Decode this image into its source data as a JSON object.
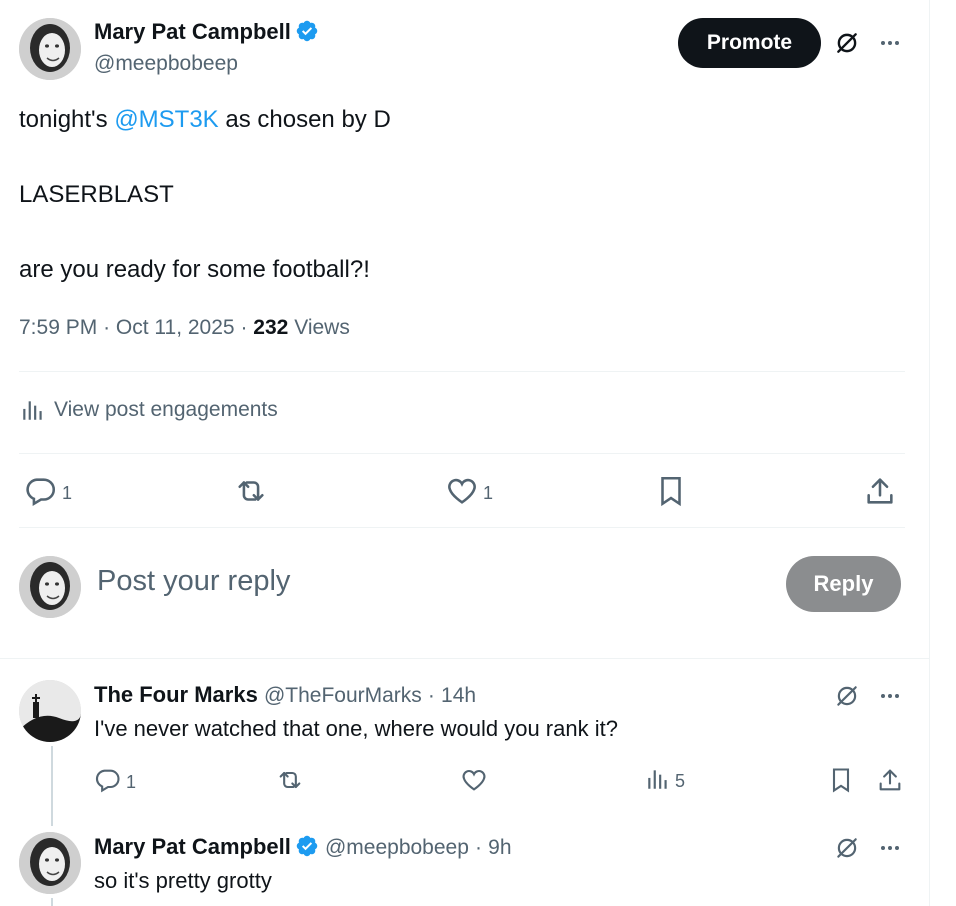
{
  "main_post": {
    "author_name": "Mary Pat Campbell",
    "author_handle": "@meepbobeep",
    "promote_label": "Promote",
    "text_prefix": "tonight's ",
    "mention": "@MST3K",
    "text_suffix": " as chosen by D",
    "line2": "LASERBLAST",
    "line3": "are you ready for some football?!",
    "time": "7:59 PM",
    "date": "Oct 11, 2025",
    "sep": "·",
    "views_count": "232",
    "views_label": "Views",
    "engagements_label": "View post engagements",
    "reply_count": "1",
    "like_count": "1"
  },
  "composer": {
    "placeholder": "Post your reply",
    "reply_button": "Reply"
  },
  "replies": [
    {
      "author_name": "The Four Marks",
      "author_handle": "@TheFourMarks",
      "time": "14h",
      "text": "I've never watched that one, where would you rank it?",
      "reply_count": "1",
      "views_count": "5"
    },
    {
      "author_name": "Mary Pat Campbell",
      "author_handle": "@meepbobeep",
      "time": "9h",
      "text": "so it's pretty grotty"
    }
  ],
  "colors": {
    "accent": "#1d9bf0",
    "text": "#0f1419",
    "muted": "#536471",
    "divider": "#eff3f4"
  }
}
